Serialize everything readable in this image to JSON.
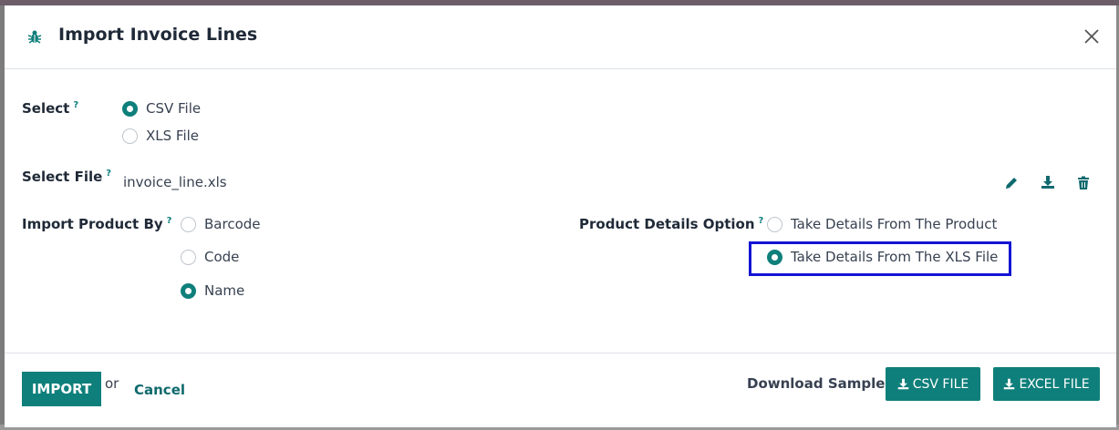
{
  "dialog": {
    "title": "Import Invoice Lines",
    "icon": "bug-icon",
    "close_icon": "close-icon"
  },
  "form": {
    "select": {
      "label": "Select",
      "help": "?",
      "options": [
        {
          "label": "CSV File",
          "checked": true
        },
        {
          "label": "XLS File",
          "checked": false
        }
      ]
    },
    "select_file": {
      "label": "Select File",
      "help": "?",
      "file_name": "invoice_line.xls",
      "actions": [
        "pencil-icon",
        "download-icon",
        "trash-icon"
      ]
    },
    "import_product_by": {
      "label": "Import Product By",
      "help": "?",
      "options": [
        {
          "label": "Barcode",
          "checked": false
        },
        {
          "label": "Code",
          "checked": false
        },
        {
          "label": "Name",
          "checked": true
        }
      ]
    },
    "product_details_option": {
      "label": "Product Details Option",
      "help": "?",
      "options": [
        {
          "label": "Take Details From The Product",
          "checked": false
        },
        {
          "label": "Take Details From The XLS File",
          "checked": true
        }
      ]
    }
  },
  "footer": {
    "import_label": "IMPORT",
    "or_text": "or",
    "cancel_label": "Cancel",
    "download_sample_label": "Download Sample:",
    "csv_button_label": "CSV FILE",
    "excel_button_label": "EXCEL FILE"
  },
  "colors": {
    "accent": "#0f7f7b",
    "highlight": "#1414d4"
  }
}
